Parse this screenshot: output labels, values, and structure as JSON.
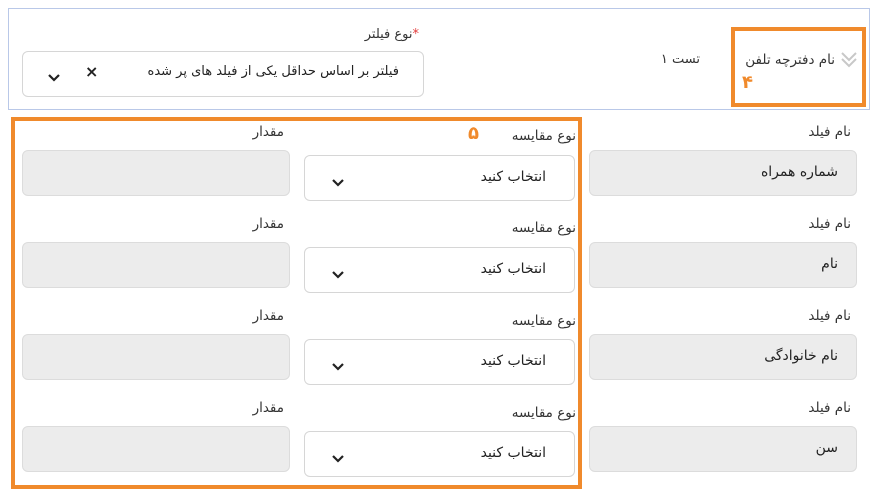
{
  "header": {
    "phonebook_name": "نام دفترچه تلفن",
    "test_label": "تست ۱",
    "step_4": "۴",
    "filter_type_label": "نوع فیلتر",
    "required_mark": "*",
    "filter_value": "فیلتر بر اساس حداقل یکی از فیلد های پر شده",
    "clear_symbol": "×"
  },
  "step_5": "۵",
  "labels": {
    "field_name": "نام فیلد",
    "compare_type": "نوع مقایسه",
    "value": "مقدار"
  },
  "rows": [
    {
      "field": "شماره همراه",
      "compare": "انتخاب کنید",
      "value": ""
    },
    {
      "field": "نام",
      "compare": "انتخاب کنید",
      "value": ""
    },
    {
      "field": "نام خانوادگی",
      "compare": "انتخاب کنید",
      "value": ""
    },
    {
      "field": "سن",
      "compare": "انتخاب کنید",
      "value": ""
    }
  ],
  "colors": {
    "highlight": "#f08a2c",
    "required": "#e23b3b",
    "card_border": "#b9c8e8",
    "field_bg": "#ececec"
  }
}
